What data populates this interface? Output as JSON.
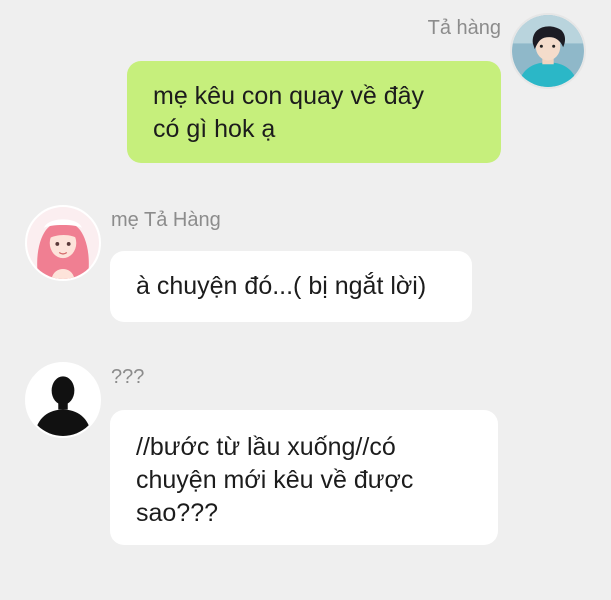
{
  "conversation": {
    "messages": [
      {
        "direction": "outgoing",
        "sender": "Tả hàng",
        "text": "mẹ kêu con quay về đây\ncó gì hok ạ",
        "avatar_icon": "boy-avatar-icon"
      },
      {
        "direction": "incoming",
        "sender": "mẹ Tả Hàng",
        "text": "à chuyện đó...( bị ngắt lời)",
        "avatar_icon": "pink-hair-girl-avatar-icon"
      },
      {
        "direction": "incoming",
        "sender": "???",
        "text": "//bước từ lầu xuống//có\nchuyện mới kêu về được\nsao???",
        "avatar_icon": "silhouette-avatar-icon"
      }
    ]
  },
  "colors": {
    "background": "#efefef",
    "outgoing_bubble": "#c6ef7c",
    "incoming_bubble": "#ffffff",
    "sender_name": "#8c8c8c",
    "message_text": "#1c1c1c"
  }
}
